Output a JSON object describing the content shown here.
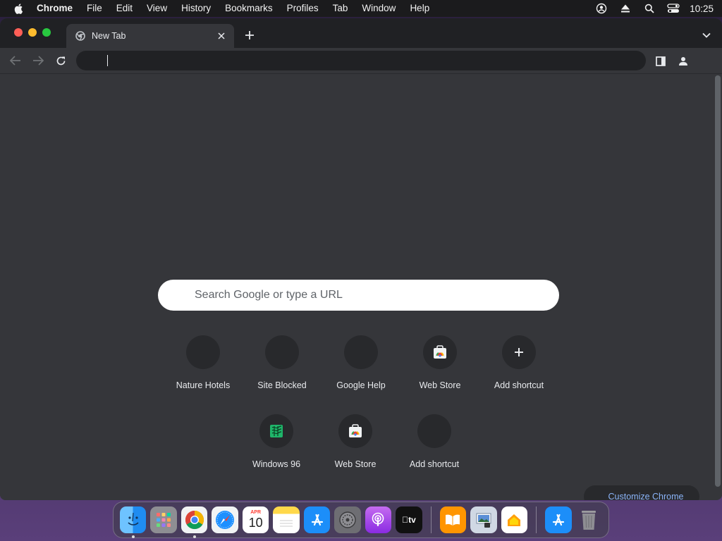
{
  "menubar": {
    "app_name": "Chrome",
    "items": [
      "File",
      "Edit",
      "View",
      "History",
      "Bookmarks",
      "Profiles",
      "Tab",
      "Window",
      "Help"
    ],
    "clock": "10:25"
  },
  "tab": {
    "title": "New Tab"
  },
  "omnibox": {
    "value": "",
    "placeholder": ""
  },
  "ntp": {
    "search_placeholder": "Search Google or type a URL",
    "shortcuts_row1": [
      "Nature Hotels",
      "Site Blocked",
      "Google Help",
      "Web Store",
      "Add shortcut"
    ],
    "shortcuts_row2": [
      "Windows 96",
      "Web Store",
      "Add shortcut"
    ],
    "customize_label": "Customize Chrome"
  },
  "dock": {
    "apps": [
      "Finder",
      "Launchpad",
      "Google Chrome",
      "Safari",
      "Calendar",
      "Notes",
      "App Store",
      "System Settings",
      "Podcasts",
      "Apple TV",
      "Books",
      "Preview",
      "Home",
      "App Store",
      "Trash"
    ],
    "calendar_month": "APR",
    "calendar_day": "10",
    "tv_label": "tv"
  },
  "colors": {
    "accent_link": "#8ab4f8",
    "frame_dark": "#202124",
    "content_bg": "#35363a",
    "tile_bg": "#28292c"
  }
}
